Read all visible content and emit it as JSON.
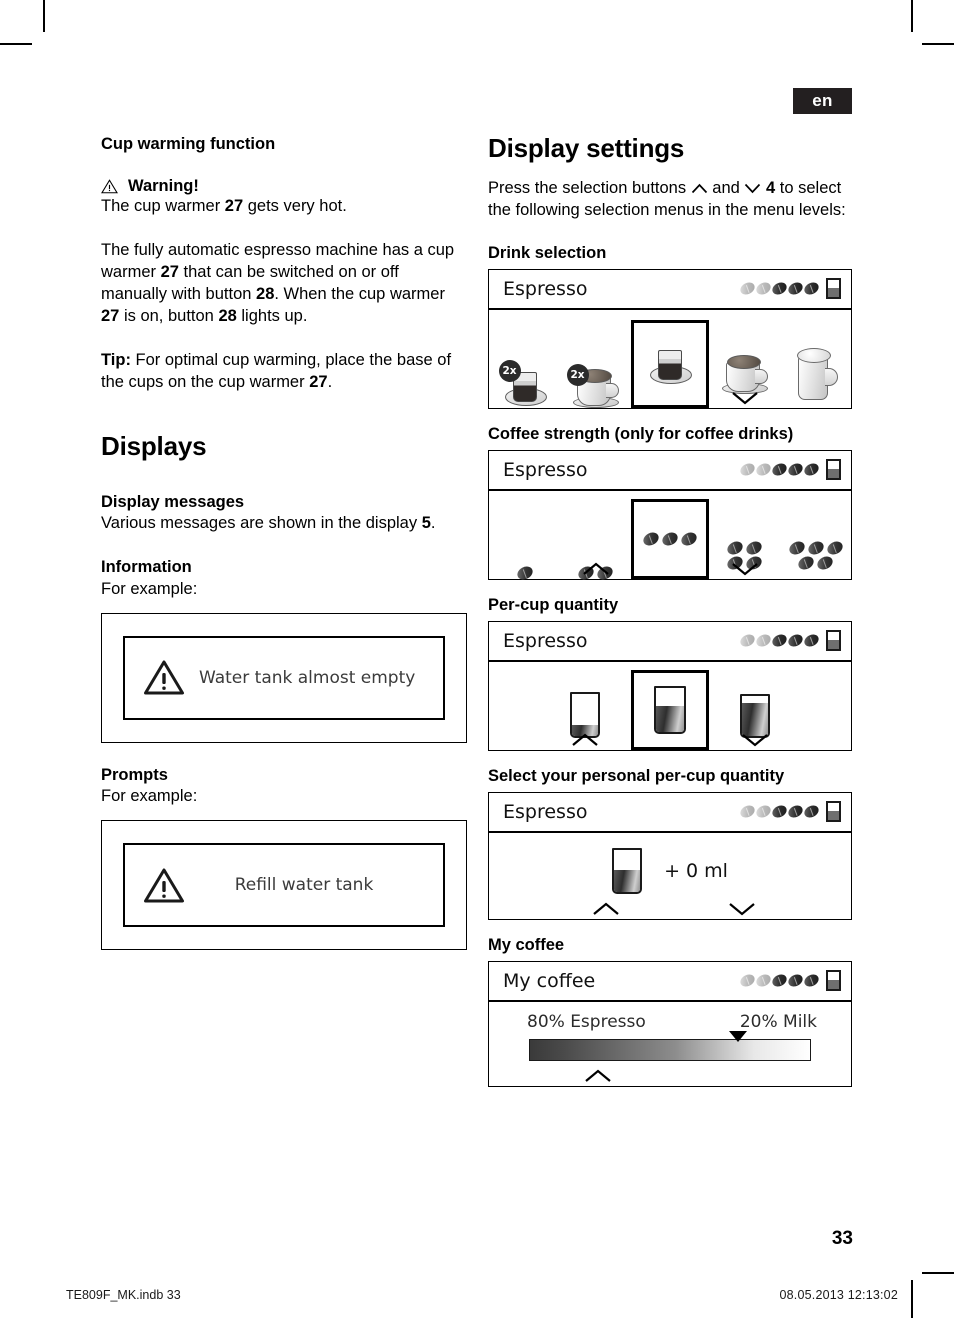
{
  "page": {
    "language_badge": "en",
    "page_number": "33",
    "footer_left": "TE809F_MK.indb   33",
    "footer_right": "08.05.2013   12:13:02"
  },
  "left_column": {
    "cup_warming": {
      "heading": "Cup warming function",
      "warning_label": "Warning!",
      "warning_text_pre": "The cup warmer ",
      "warning_ref": "27",
      "warning_text_post": " gets very hot.",
      "para1": "The fully automatic espresso machine has a cup warmer 27 that can be switched on or off manually with button 28. When the cup warmer 27 is on, button 28 lights up.",
      "tip_label": "Tip:",
      "tip_text": " For optimal cup warming, place the base of the cups on the cup warmer 27."
    },
    "displays": {
      "heading": "Displays",
      "display_messages_heading": "Display messages",
      "display_messages_text": "Various messages are shown in the display 5.",
      "information_heading": "Information",
      "information_example_label": "For example:",
      "information_message": "Water tank almost empty",
      "prompts_heading": "Prompts",
      "prompts_example_label": "For example:",
      "prompts_message": "Refill water tank"
    }
  },
  "right_column": {
    "heading": "Display settings",
    "intro_pre": "Press the selection buttons ",
    "intro_and": " and ",
    "intro_ref": "4",
    "intro_post": " to select the following selection menus in the menu levels:",
    "panels": [
      {
        "label": "Drink selection",
        "display_title": "Espresso",
        "beans_filled": 3,
        "beans_total": 5,
        "items": [
          {
            "icon": "espresso-double-icon",
            "badge": "2x",
            "selected": false
          },
          {
            "icon": "coffee-cup-double-icon",
            "badge": "2x",
            "selected": false
          },
          {
            "icon": "espresso-icon",
            "badge": "",
            "selected": true
          },
          {
            "icon": "coffee-cup-icon",
            "badge": "",
            "selected": false
          },
          {
            "icon": "tall-mug-icon",
            "badge": "",
            "selected": false
          }
        ],
        "chevron_up": false,
        "chevron_down": true
      },
      {
        "label": "Coffee strength (only for coffee drinks)",
        "display_title": "Espresso",
        "beans_filled": 3,
        "beans_total": 5,
        "items": [
          {
            "icon": "strength-1-icon",
            "count": 1,
            "selected": false
          },
          {
            "icon": "strength-2-icon",
            "count": 2,
            "selected": false
          },
          {
            "icon": "strength-3-icon",
            "count": 3,
            "selected": true
          },
          {
            "icon": "strength-4-icon",
            "count": 4,
            "selected": false
          },
          {
            "icon": "strength-5-icon",
            "count": 5,
            "selected": false
          }
        ],
        "chevron_up": true,
        "chevron_down": true
      },
      {
        "label": "Per-cup quantity",
        "display_title": "Espresso",
        "beans_filled": 3,
        "beans_total": 5,
        "items": [
          {
            "icon": "glass-small-icon",
            "fill_percent": 26,
            "selected": false
          },
          {
            "icon": "glass-medium-icon",
            "fill_percent": 58,
            "selected": true
          },
          {
            "icon": "glass-large-icon",
            "fill_percent": 82,
            "selected": false
          }
        ],
        "chevron_up": true,
        "chevron_down": true
      },
      {
        "label": "Select your personal per-cup quantity",
        "display_title": "Espresso",
        "beans_filled": 3,
        "beans_total": 5,
        "value": "+ 0 ml",
        "glass_fill_percent": 52,
        "chevron_up": true,
        "chevron_down": true
      },
      {
        "label": "My coffee",
        "display_title": "My coffee",
        "beans_filled": 3,
        "beans_total": 5,
        "left_value": "80% Espresso",
        "right_value": "20% Milk",
        "marker_position_percent": 71,
        "chevron_up": true,
        "chevron_down": false
      }
    ]
  }
}
